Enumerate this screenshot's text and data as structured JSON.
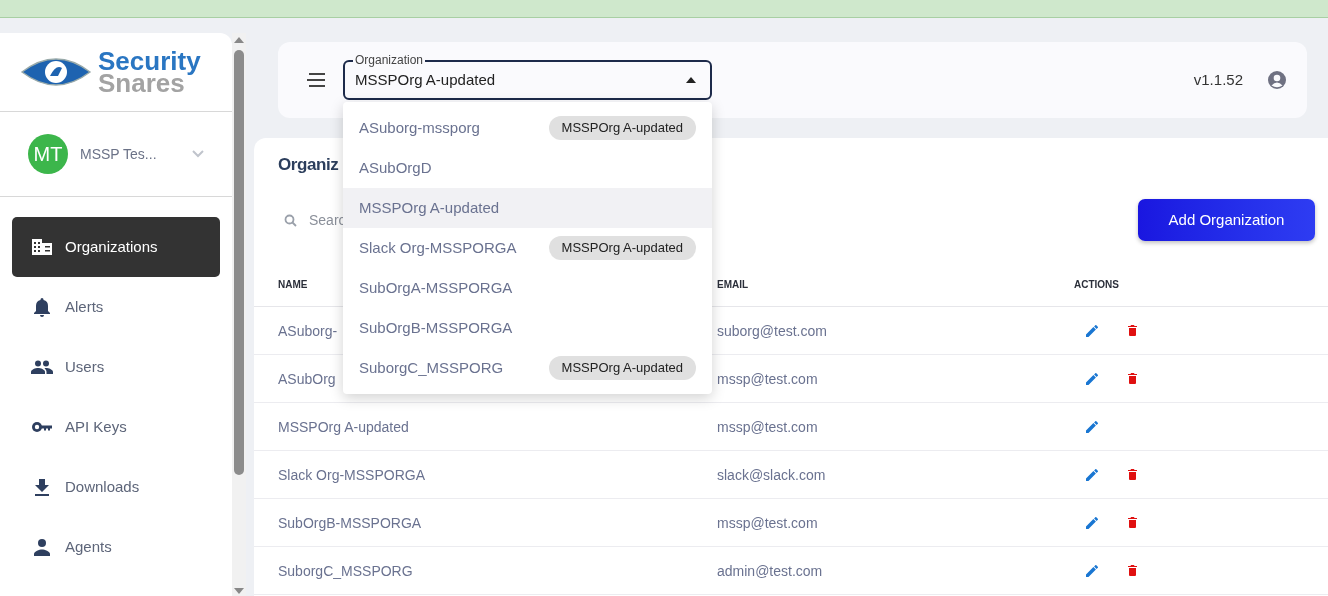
{
  "sidebar": {
    "logo": {
      "line1": "Security",
      "line2": "Snares"
    },
    "user": {
      "initials": "MT",
      "name": "MSSP Tes..."
    },
    "items": [
      {
        "label": "Organizations",
        "kind": "building",
        "selected": true
      },
      {
        "label": "Alerts",
        "kind": "bell",
        "selected": false
      },
      {
        "label": "Users",
        "kind": "group",
        "selected": false
      },
      {
        "label": "API Keys",
        "kind": "key",
        "selected": false
      },
      {
        "label": "Downloads",
        "kind": "download",
        "selected": false
      },
      {
        "label": "Agents",
        "kind": "person",
        "selected": false
      }
    ]
  },
  "topbar": {
    "org_select": {
      "label": "Organization",
      "value": "MSSPOrg A-updated",
      "expanded": true
    },
    "version": "v1.1.52"
  },
  "dropdown": {
    "options": [
      {
        "label": "ASuborg-mssporg",
        "parent": "MSSPOrg A-updated",
        "selected": false
      },
      {
        "label": "ASubOrgD",
        "selected": false
      },
      {
        "label": "MSSPOrg A-updated",
        "selected": true
      },
      {
        "label": "Slack Org-MSSPORGA",
        "parent": "MSSPOrg A-updated",
        "selected": false
      },
      {
        "label": "SubOrgA-MSSPORGA",
        "selected": false
      },
      {
        "label": "SubOrgB-MSSPORGA",
        "selected": false
      },
      {
        "label": "SuborgC_MSSPORG",
        "parent": "MSSPOrg A-updated",
        "selected": false
      }
    ]
  },
  "page": {
    "title": "Organiz",
    "search_placeholder": "Searc",
    "add_button": "Add Organization",
    "columns": [
      "NAME",
      "EMAIL",
      "ACTIONS"
    ],
    "rows": [
      {
        "name": "ASuborg-",
        "email": "suborg@test.com",
        "deletable": true
      },
      {
        "name": "ASubOrg",
        "email": "mssp@test.com",
        "deletable": true
      },
      {
        "name": "MSSPOrg A-updated",
        "email": "mssp@test.com",
        "deletable": false
      },
      {
        "name": "Slack Org-MSSPORGA",
        "email": "slack@slack.com",
        "deletable": true
      },
      {
        "name": "SubOrgB-MSSPORGA",
        "email": "mssp@test.com",
        "deletable": true
      },
      {
        "name": "SuborgC_MSSPORG",
        "email": "admin@test.com",
        "deletable": true
      }
    ]
  }
}
